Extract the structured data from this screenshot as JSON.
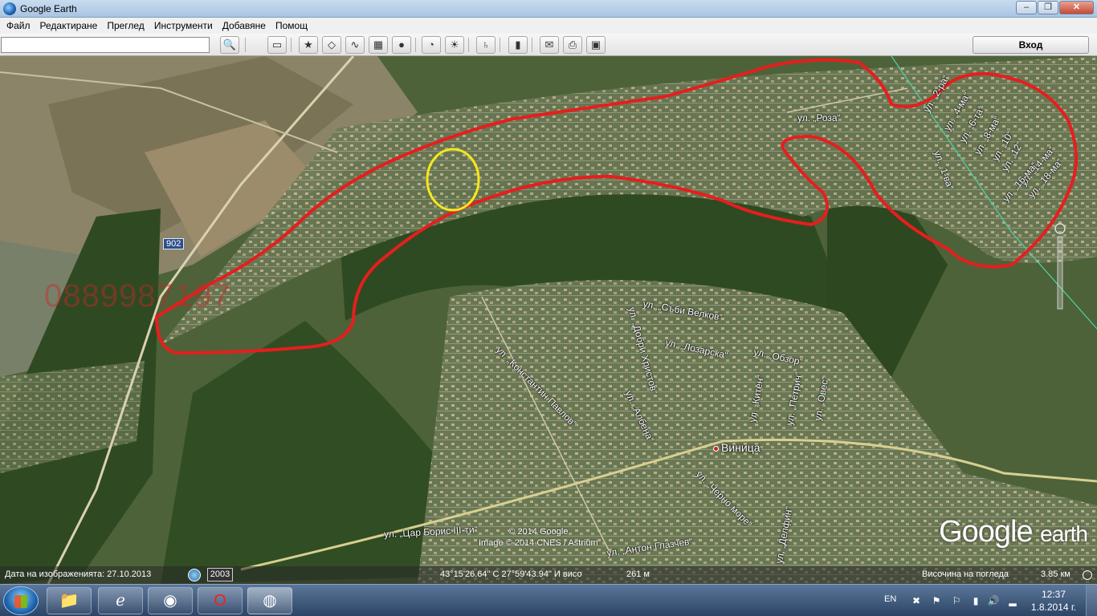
{
  "window": {
    "title": "Google Earth"
  },
  "menu": [
    "Файл",
    "Редактиране",
    "Преглед",
    "Инструменти",
    "Добавяне",
    "Помощ"
  ],
  "toolbar": {
    "search_value": "",
    "login_label": "Вход"
  },
  "map": {
    "street_labels": [
      "ул. „Роза“",
      "ул. „2-ра“",
      "ул. „4-ма“",
      "ул. „6-та“",
      "ул. „8-ма“",
      "ул. „10“",
      "ул. „12“",
      "ул. „14-ма“",
      "ул. „16-ма“",
      "ул. „18-ма“",
      "ул. „1-ва“",
      "ул. „Съби Велков“",
      "ул. „Добри Христов“",
      "ул. „Лозарска“",
      "ул. „Обзор“",
      "ул. „Константин Павлов“",
      "ул. „Албена“",
      "ул. „Китен“",
      "ул. „Петрич“",
      "ул. „Овес“",
      "ул. „Черно море“",
      "ул. „Делфин“",
      "ул. „Цар Борис III-ти“",
      "ул. „Антон Глазчев“"
    ],
    "road_number": "902",
    "watermark": "0889987197",
    "town": "Виница",
    "copyright_1": "© 2014 Google",
    "copyright_2": "Image © 2014 CNES / Astrium",
    "brand_1": "Google",
    "brand_2": "earth",
    "outline_color": "#e61e1e",
    "highlight_color": "#f5e81a"
  },
  "status": {
    "imagery_label": "Дата на изображенията: 27.10.2013",
    "year": "2003",
    "coordinates": "43°15'26.64\" С   27°59'43.94\" И   висо",
    "elevation": "261 м",
    "eye_alt_label": "Височина на погледа",
    "eye_alt_value": "3.85 км"
  },
  "taskbar": {
    "language": "EN",
    "time": "12:37",
    "date": "1.8.2014 г."
  }
}
